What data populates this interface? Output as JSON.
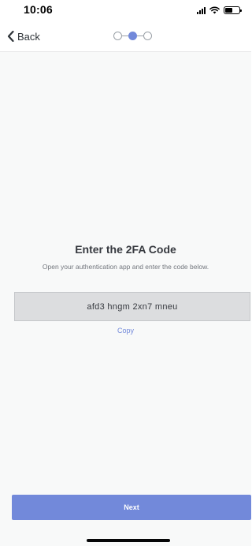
{
  "status_bar": {
    "time": "10:06",
    "battery_level": 0.55,
    "icons": [
      "signal-icon",
      "wifi-icon",
      "battery-icon"
    ]
  },
  "header": {
    "back_label": "Back",
    "back_icon": "chevron-left-icon",
    "steps_total": 3,
    "current_step": 2
  },
  "main": {
    "title": "Enter the 2FA Code",
    "subtitle": "Open your authentication app and enter the code below.",
    "code": "afd3 hngm 2xn7 mneu",
    "copy_label": "Copy"
  },
  "footer": {
    "next_label": "Next"
  },
  "colors": {
    "accent": "#7289da",
    "background": "#f8f9f9",
    "code_box": "#dcdddf",
    "title_text": "#36393f",
    "muted_text": "#72767d"
  }
}
